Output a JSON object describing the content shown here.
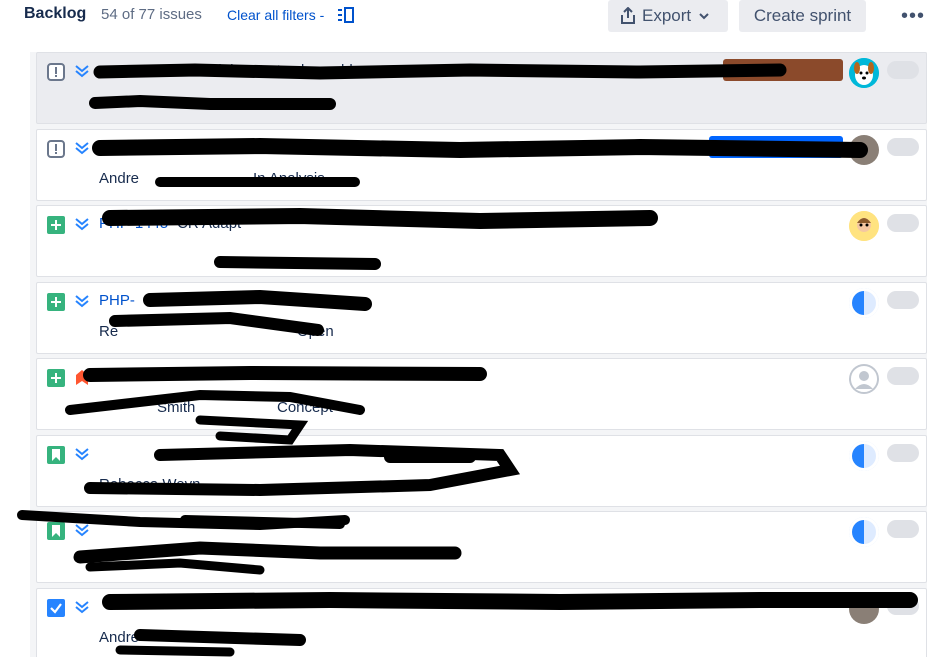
{
  "header": {
    "title": "Backlog",
    "count": "54 of 77 issues",
    "clear_filters": "Clear all filters -",
    "export_label": "Export",
    "create_sprint_label": "Create sprint",
    "more_label": "•••"
  },
  "issues": [
    {
      "type": "impediment",
      "priority": "lowest",
      "key": "",
      "summary": "SP ziehen trotz abgeschlossen",
      "assignee": "",
      "status": "",
      "avatar": "dog",
      "label": "",
      "label_color": "#8b4a2b"
    },
    {
      "type": "impediment",
      "priority": "lowest",
      "key": "",
      "summary": "",
      "assignee": "Andre",
      "status": "In Analysis",
      "avatar": "photo",
      "label": "",
      "label_color": "#0065ff"
    },
    {
      "type": "new-feature",
      "priority": "lowest",
      "key": "PHP-1445",
      "summary": "CR Adapt",
      "assignee": "",
      "status": "",
      "avatar": "cartoon",
      "label": "",
      "label_color": ""
    },
    {
      "type": "new-feature",
      "priority": "lowest",
      "key": "PHP-",
      "summary": "",
      "assignee": "Re",
      "status": "Open",
      "avatar": "globe",
      "label": "",
      "label_color": ""
    },
    {
      "type": "new-feature",
      "priority": "highest",
      "key": "PHP-1000",
      "summary": "",
      "assignee": "Smith",
      "status": "Concept",
      "avatar": "default",
      "label": "",
      "label_color": ""
    },
    {
      "type": "story",
      "priority": "lowest",
      "key": "",
      "summary": "",
      "assignee": "Rebecca Weyn",
      "status": "",
      "avatar": "globe",
      "label": "",
      "label_color": ""
    },
    {
      "type": "story",
      "priority": "lowest",
      "key": "",
      "summary": "",
      "assignee": "",
      "status": "",
      "avatar": "globe",
      "label": "",
      "label_color": ""
    },
    {
      "type": "task",
      "priority": "lowest",
      "key": "",
      "summary": "",
      "assignee": "Andre",
      "status": "",
      "avatar": "photo",
      "label": "",
      "label_color": ""
    }
  ],
  "colors": {
    "link": "#0052cc",
    "new_feature": "#36b37e",
    "story": "#36b37e",
    "task": "#2684ff",
    "priority_low": "#2684ff",
    "priority_high": "#ff5630"
  }
}
